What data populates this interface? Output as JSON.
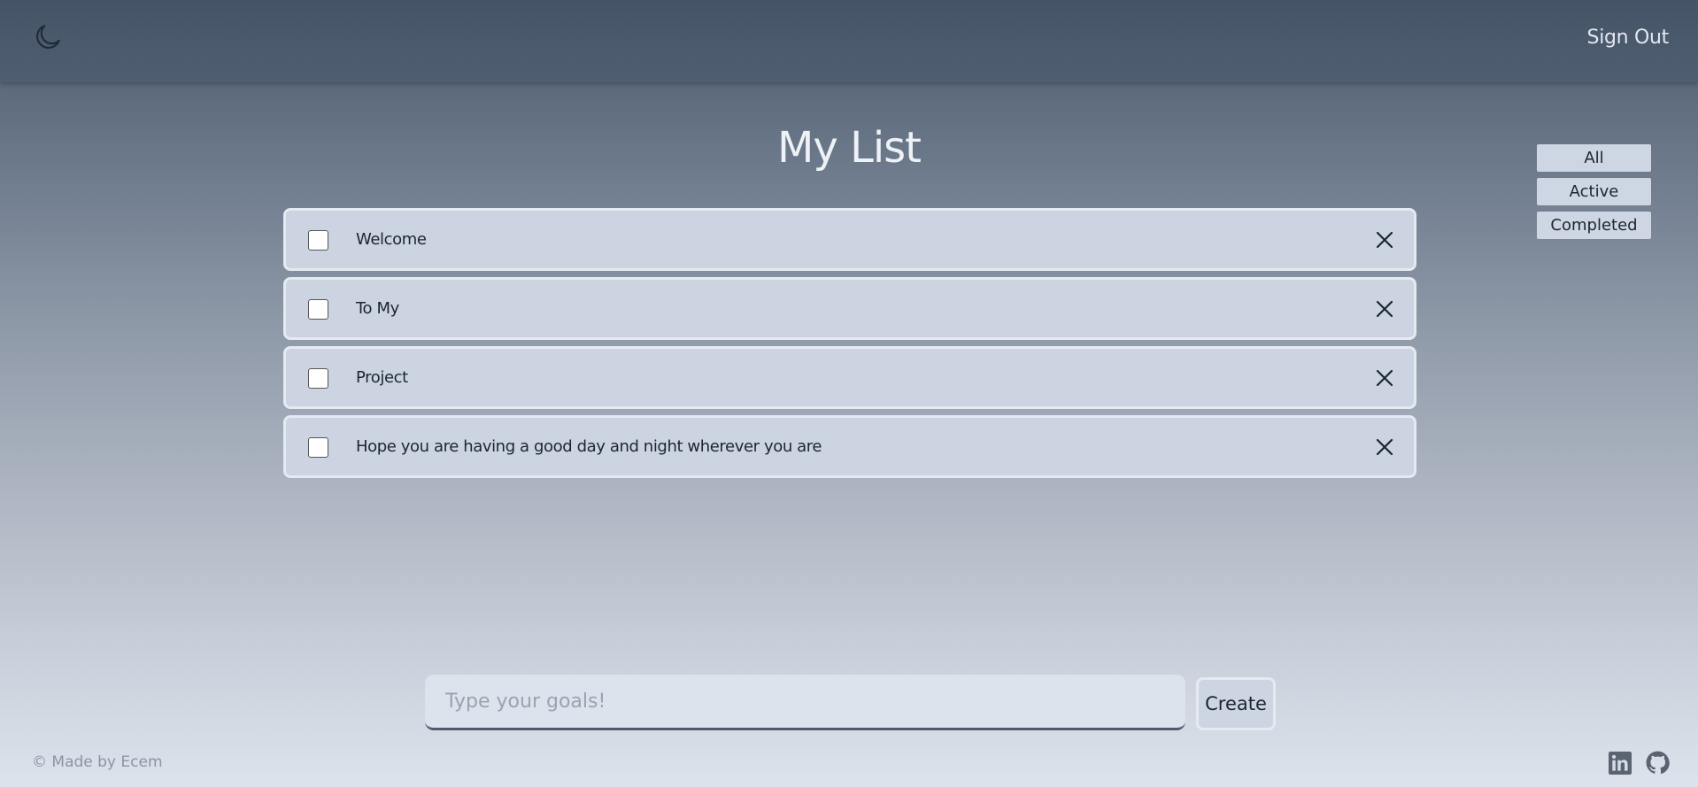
{
  "header": {
    "theme_icon": "moon-icon",
    "signout_label": "Sign Out"
  },
  "main": {
    "title": "My List"
  },
  "filters": [
    {
      "label": "All"
    },
    {
      "label": "Active"
    },
    {
      "label": "Completed"
    }
  ],
  "todos": [
    {
      "text": "Welcome",
      "checked": false
    },
    {
      "text": "To My",
      "checked": false
    },
    {
      "text": "Project",
      "checked": false
    },
    {
      "text": "Hope you are having a good day and night wherever you are",
      "checked": false
    }
  ],
  "form": {
    "placeholder": "Type your goals!",
    "value": "",
    "create_label": "Create"
  },
  "footer": {
    "credit": "© Made by Ecem",
    "icons": [
      "linkedin-icon",
      "github-icon"
    ]
  },
  "colors": {
    "header_bg": "#455467",
    "item_bg": "#cbd4e0",
    "item_border": "#e5eaf2",
    "title_text": "#eef1f6",
    "text_dark": "#1d2533"
  }
}
